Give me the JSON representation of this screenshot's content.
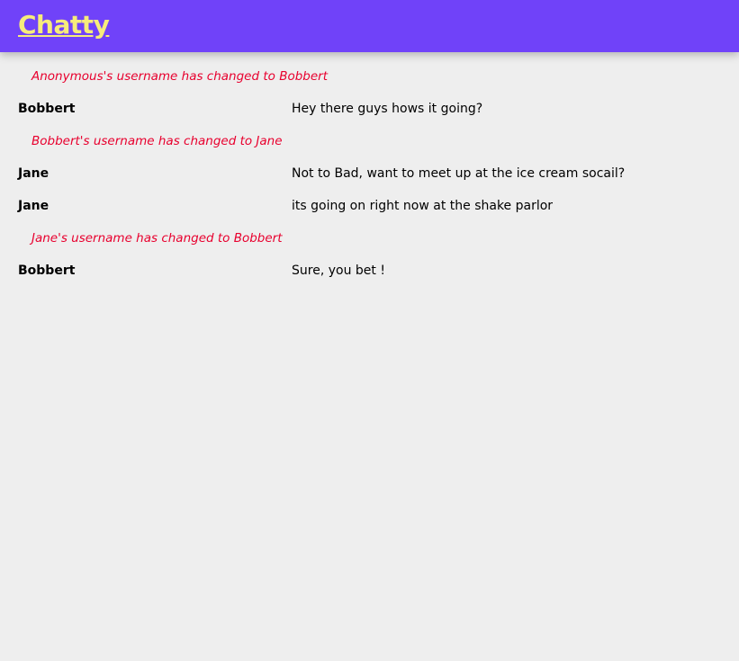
{
  "app": {
    "brand": "Chatty",
    "colors": {
      "navbar": "#7042f9",
      "brand_text": "#f6ec7b",
      "background": "#eeeeee",
      "system_text": "#e8002e"
    }
  },
  "messages": [
    {
      "type": "system",
      "text": "Anonymous's username has changed to Bobbert"
    },
    {
      "type": "message",
      "username": "Bobbert",
      "content": "Hey there guys hows it going?"
    },
    {
      "type": "system",
      "text": "Bobbert's username has changed to Jane"
    },
    {
      "type": "message",
      "username": "Jane",
      "content": "Not to Bad, want to meet up at the ice cream socail?"
    },
    {
      "type": "message",
      "username": "Jane",
      "content": "its going on right now at the shake parlor"
    },
    {
      "type": "system",
      "text": "Jane's username has changed to Bobbert"
    },
    {
      "type": "message",
      "username": "Bobbert",
      "content": "Sure, you bet !"
    }
  ]
}
